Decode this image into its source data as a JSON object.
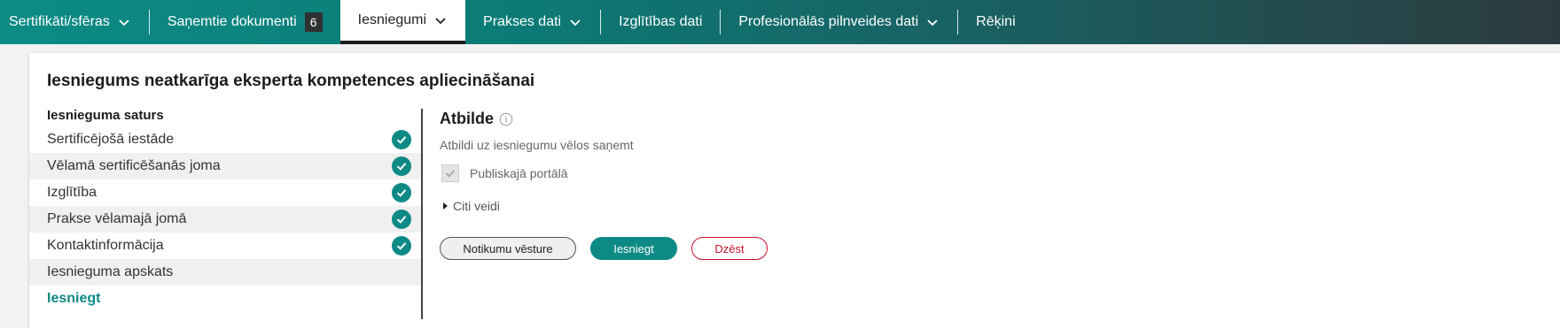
{
  "nav": {
    "items": [
      {
        "label": "Sertifikāti/sfēras",
        "has_dropdown": true
      },
      {
        "label": "Saņemtie dokumenti",
        "badge": "6"
      },
      {
        "label": "Iesniegumi",
        "has_dropdown": true,
        "active": true
      },
      {
        "label": "Prakses dati",
        "has_dropdown": true
      },
      {
        "label": "Izglītības dati"
      },
      {
        "label": "Profesionālās pilnveides dati",
        "has_dropdown": true
      },
      {
        "label": "Rēķini"
      }
    ]
  },
  "page": {
    "title": "Iesniegums neatkarīga eksperta kompetences apliecināšanai"
  },
  "steps": {
    "header": "Iesnieguma saturs",
    "items": [
      {
        "label": "Sertificējošā iestāde",
        "completed": true
      },
      {
        "label": "Vēlamā sertificēšanās joma",
        "completed": true
      },
      {
        "label": "Izglītība",
        "completed": true
      },
      {
        "label": "Prakse vēlamajā jomā",
        "completed": true
      },
      {
        "label": "Kontaktinformācija",
        "completed": true
      },
      {
        "label": "Iesnieguma apskats",
        "completed": false
      },
      {
        "label": "Iesniegt",
        "completed": false,
        "current": true
      }
    ]
  },
  "answer": {
    "title": "Atbilde",
    "subtitle": "Atbildi uz iesniegumu vēlos saņemt",
    "checkbox_label": "Publiskajā portālā",
    "checkbox_checked": true,
    "other_label": "Citi veidi"
  },
  "actions": {
    "history": "Notikumu vēsture",
    "submit": "Iesniegt",
    "delete": "Dzēst"
  },
  "colors": {
    "accent": "#0d8a85",
    "danger": "#c8102e",
    "nav_dark": "#2c3a3e"
  }
}
